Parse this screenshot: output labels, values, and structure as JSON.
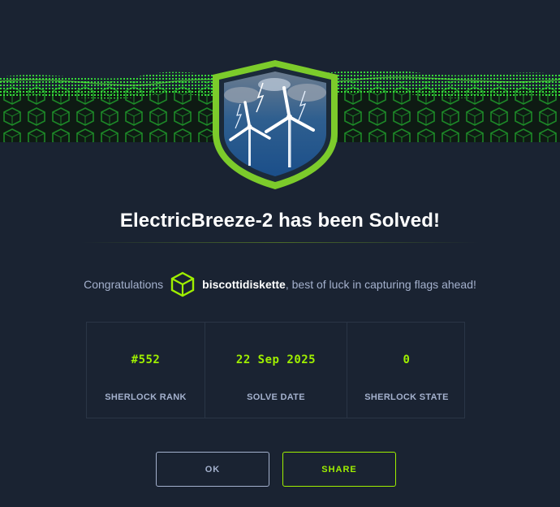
{
  "header": {
    "title": "ElectricBreeze-2 has been Solved!"
  },
  "message": {
    "prefix": "Congratulations",
    "username": "biscottidiskette",
    "suffix": ", best of luck in capturing flags ahead!"
  },
  "stats": [
    {
      "value": "#552",
      "label": "SHERLOCK RANK"
    },
    {
      "value": "22 Sep 2025",
      "label": "SOLVE DATE"
    },
    {
      "value": "0",
      "label": "SHERLOCK STATE"
    }
  ],
  "buttons": {
    "ok_label": "OK",
    "share_label": "SHARE"
  },
  "colors": {
    "background": "#1a2332",
    "accent": "#9fef00",
    "muted_text": "#a4b1cd",
    "badge_border": "#7ccb2b"
  },
  "icons": {
    "avatar": "hex-cube-icon",
    "badge": "wind-turbine-shield-icon"
  }
}
